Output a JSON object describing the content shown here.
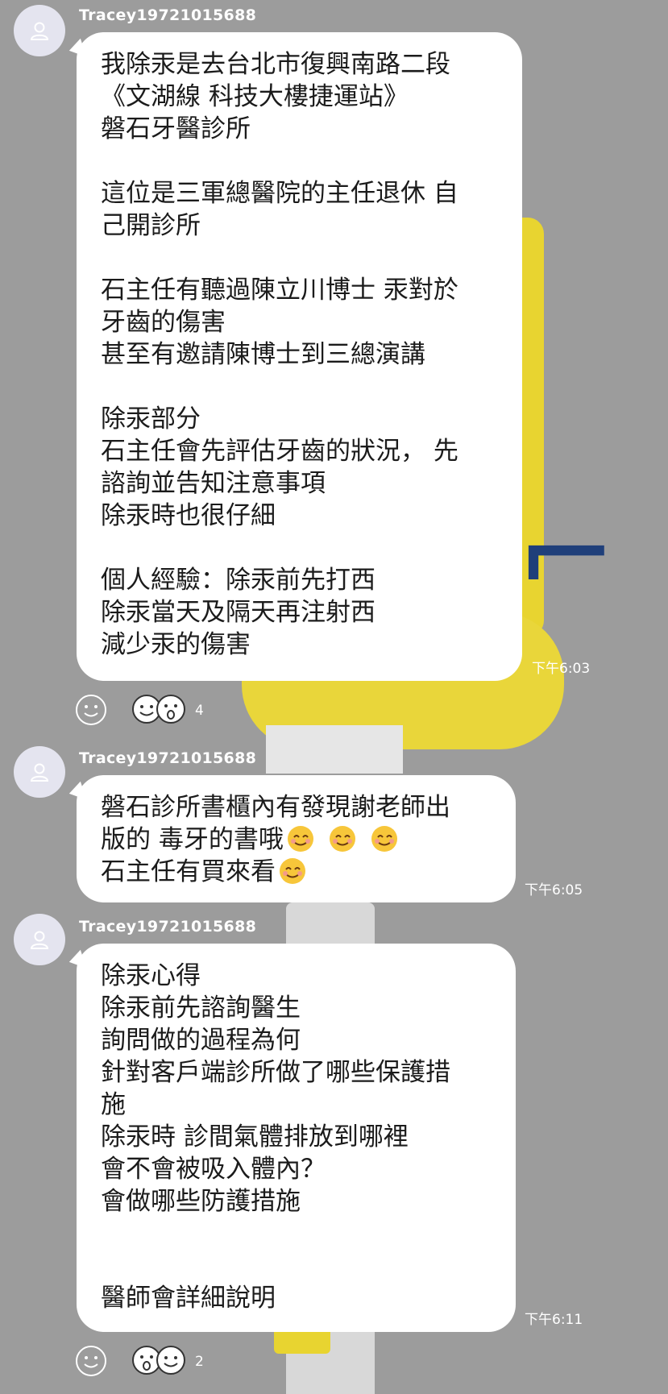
{
  "colors": {
    "background": "#9c9c9c",
    "bubble": "#ffffff",
    "text": "#1b1b1b",
    "meta": "#ffffff"
  },
  "messages": [
    {
      "sender": "Tracey19721015688",
      "lines": [
        "我除汞是去台北市復興南路二段",
        "《文湖線 科技大樓捷運站》",
        "磐石牙醫診所",
        "",
        "這位是三軍總醫院的主任退休 自",
        "己開診所",
        "",
        "石主任有聽過陳立川博士 汞對於",
        "牙齒的傷害",
        "甚至有邀請陳博士到三總演講",
        "",
        "除汞部分",
        "石主任會先評估牙齒的狀況， 先",
        "諮詢並告知注意事項",
        "除汞時也很仔細",
        "",
        "個人經驗：除汞前先打西",
        "除汞當天及隔天再注射西",
        "減少汞的傷害"
      ],
      "time": "下午6:03",
      "reactions": {
        "count": "4",
        "icons": [
          "smile-reaction-icon",
          "surprised-reaction-icon"
        ]
      }
    },
    {
      "sender": "Tracey19721015688",
      "lines": [
        "磐石診所書櫃內有發現謝老師出",
        "版的 毒牙的書哦",
        "石主任有買來看"
      ],
      "emoji": "smiling-face-emoji",
      "time": "下午6:05"
    },
    {
      "sender": "Tracey19721015688",
      "lines": [
        "除汞心得",
        "除汞前先諮詢醫生",
        "詢問做的過程為何",
        "針對客戶端診所做了哪些保護措",
        "施",
        "除汞時 診間氣體排放到哪裡",
        "會不會被吸入體內？",
        "會做哪些防護措施",
        "",
        "",
        "醫師會詳細說明"
      ],
      "time": "下午6:11",
      "reactions": {
        "count": "2",
        "icons": [
          "surprised-reaction-icon",
          "smile-reaction-icon"
        ]
      }
    }
  ]
}
